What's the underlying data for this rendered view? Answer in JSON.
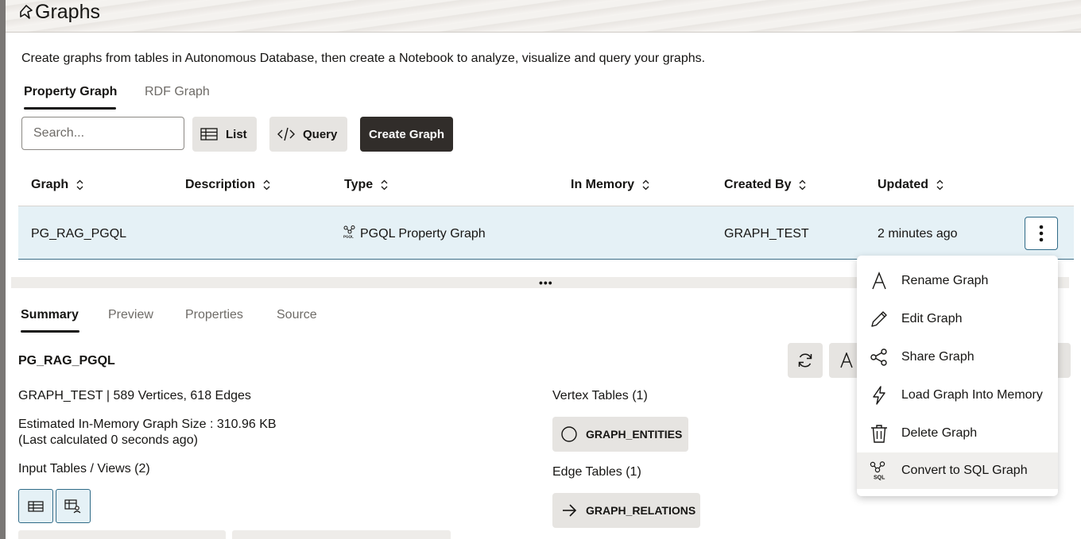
{
  "header": {
    "title": "Graphs"
  },
  "intro_text": "Create graphs from tables in Autonomous Database, then create a Notebook to analyze, visualize and query your graphs.",
  "top_tabs": [
    {
      "label": "Property Graph",
      "active": true
    },
    {
      "label": "RDF Graph",
      "active": false
    }
  ],
  "toolbar": {
    "search_placeholder": "Search...",
    "list_label": "List",
    "query_label": "Query",
    "create_label": "Create Graph"
  },
  "table": {
    "columns": [
      "Graph",
      "Description",
      "Type",
      "In Memory",
      "Created By",
      "Updated"
    ],
    "rows": [
      {
        "graph": "PG_RAG_PGQL",
        "description": "",
        "type": "PGQL Property Graph",
        "in_memory": "",
        "created_by": "GRAPH_TEST",
        "updated": "2 minutes ago"
      }
    ]
  },
  "detail_tabs": [
    {
      "label": "Summary",
      "active": true
    },
    {
      "label": "Preview",
      "active": false
    },
    {
      "label": "Properties",
      "active": false
    },
    {
      "label": "Source",
      "active": false
    }
  ],
  "summary": {
    "graph_name": "PG_RAG_PGQL",
    "owner_stats": "GRAPH_TEST | 589 Vertices, 618 Edges",
    "size_line": "Estimated In-Memory Graph Size : 310.96 KB",
    "calc_line": "(Last calculated 0 seconds ago)",
    "input_tables_label": "Input Tables / Views (2)",
    "vertex_tables_label": "Vertex Tables (1)",
    "vertex_tables": [
      "GRAPH_ENTITIES"
    ],
    "edge_tables_label": "Edge Tables (1)",
    "edge_tables": [
      "GRAPH_RELATIONS"
    ]
  },
  "context_menu": {
    "items": [
      {
        "label": "Rename Graph",
        "icon": "rename-icon"
      },
      {
        "label": "Edit Graph",
        "icon": "pencil-icon"
      },
      {
        "label": "Share Graph",
        "icon": "share-icon"
      },
      {
        "label": "Load Graph Into Memory",
        "icon": "lightning-icon"
      },
      {
        "label": "Delete Graph",
        "icon": "trash-icon"
      },
      {
        "label": "Convert to SQL Graph",
        "icon": "sql-graph-icon",
        "highlighted": true
      }
    ]
  },
  "colors": {
    "selected_row": "#e5f1f6",
    "primary_button": "#312d2a",
    "accent_border": "#2f6a87"
  }
}
